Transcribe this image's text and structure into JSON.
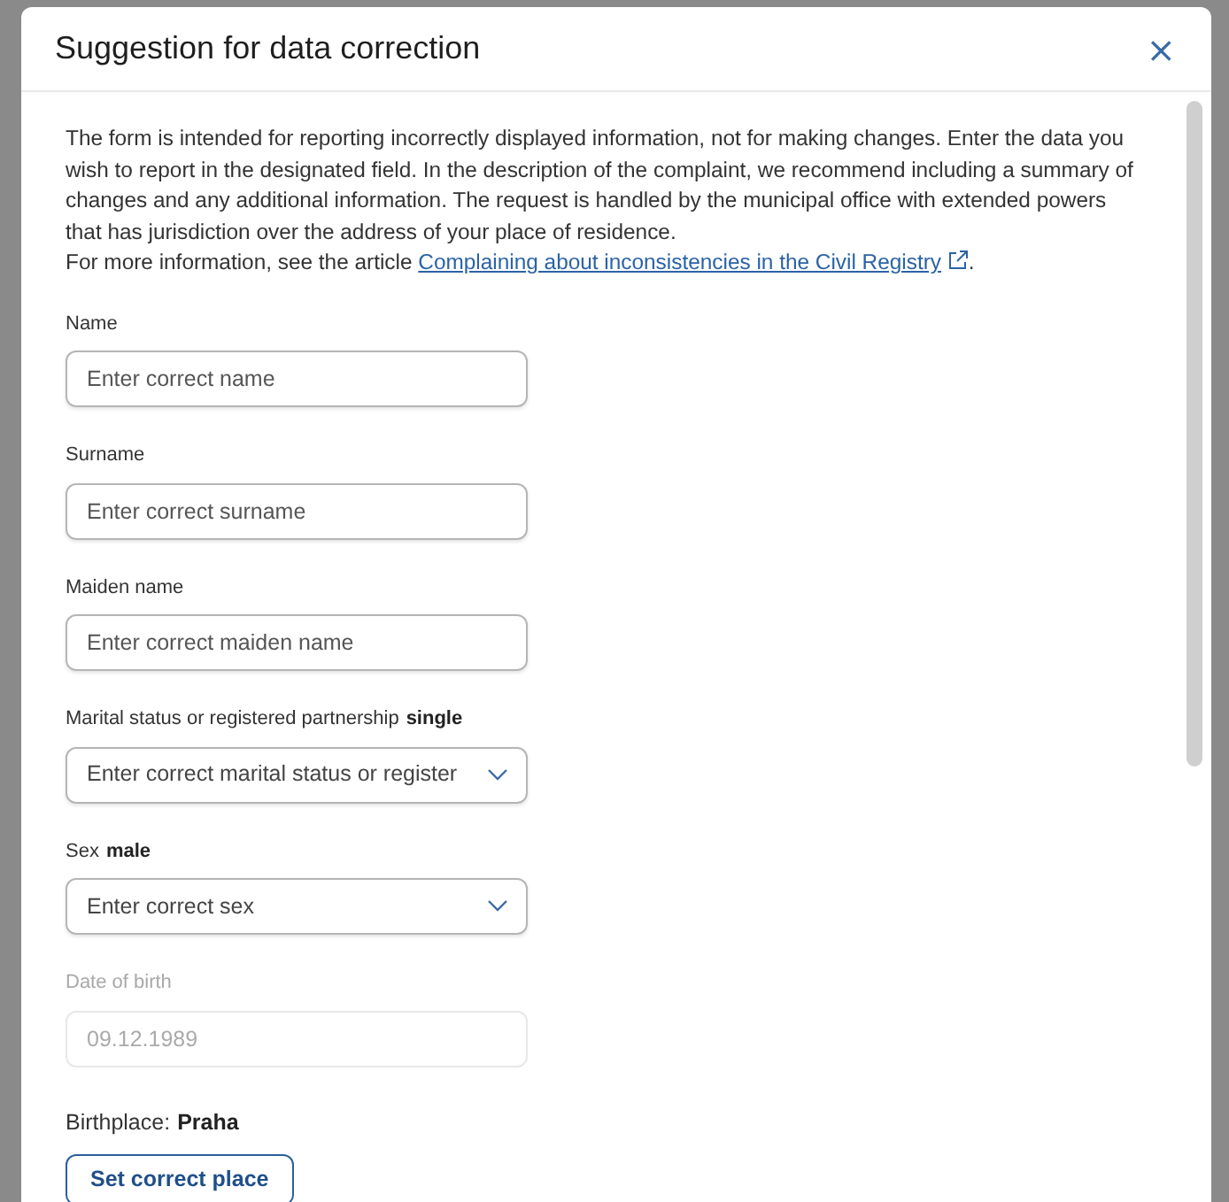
{
  "dialog": {
    "title": "Suggestion for data correction",
    "close_label": "×"
  },
  "intro": {
    "text": "The form is intended for reporting incorrectly displayed information, not for making changes. Enter the data you wish to report in the designated field. In the description of the complaint, we recommend including a summary of changes and any additional information. The request is handled by the municipal office with extended powers that has jurisdiction over the address of your place of residence.",
    "more_text": "For more information, see the article",
    "link": "Complaining about inconsistencies in the Civil Registry",
    "after_link": "."
  },
  "fields": [
    {
      "kind": "text",
      "label": "Name",
      "placeholder": "Enter correct name",
      "disabled": false
    },
    {
      "kind": "text",
      "label": "Surname",
      "placeholder": "Enter correct surname",
      "disabled": false
    },
    {
      "kind": "text",
      "label": "Maiden name",
      "placeholder": "Enter correct maiden name",
      "disabled": false
    },
    {
      "kind": "select",
      "label": "Marital status or registered partnership",
      "current": "single",
      "placeholder": "Enter correct marital status or register",
      "disabled": false
    },
    {
      "kind": "select",
      "label": "Sex",
      "current": "male",
      "placeholder": "Enter correct sex",
      "disabled": false
    },
    {
      "kind": "text",
      "label": "Date of birth",
      "value": "09.12.1989",
      "disabled": true
    }
  ],
  "birthplace": {
    "label": "Birthplace:",
    "value": "Praha",
    "button": "Set correct place"
  }
}
